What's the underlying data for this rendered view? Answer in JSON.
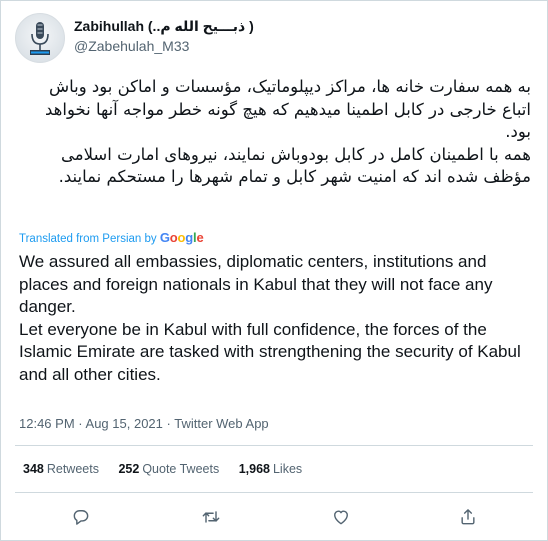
{
  "tweet": {
    "display_name": "Zabihullah (..ذبـــیح الله م )",
    "handle": "@Zabehulah_M33",
    "persian_text": [
      "به همه سفارت خانه ها، مراکز دیپلوماتیک، مؤسسات و اماکن بود وباش اتباع خارجی در کابل اطمینا میدهیم که هیچ گونه خطر مواجه آنها نخواهد بود.",
      "همه با اطمینان کامل در کابل بودوباش نمایند، نیروهای امارت اسلامی مؤظف شده اند که امنیت شهر کابل و تمام شهرها را مستحکم نمایند."
    ],
    "translated_label": "Translated from Persian by",
    "translated_provider": "Google",
    "english_text": "We assured all embassies, diplomatic centers, institutions and places and foreign nationals in Kabul that they will not face any danger.\n Let everyone be in Kabul with full confidence, the forces of the Islamic Emirate are tasked with strengthening the security of Kabul and all other cities.",
    "time": "12:46 PM",
    "date": "Aug 15, 2021",
    "source": "Twitter Web App",
    "separator": "·",
    "stats": {
      "retweets_count": "348",
      "retweets_label": "Retweets",
      "quotes_count": "252",
      "quotes_label": "Quote Tweets",
      "likes_count": "1,968",
      "likes_label": "Likes"
    },
    "actions": [
      "reply-icon",
      "retweet-icon",
      "like-icon",
      "share-icon"
    ]
  },
  "colors": {
    "link_blue": "#1d9bf0",
    "muted_gray": "#536471",
    "border": "#cfd9de",
    "text": "#0f1419"
  }
}
